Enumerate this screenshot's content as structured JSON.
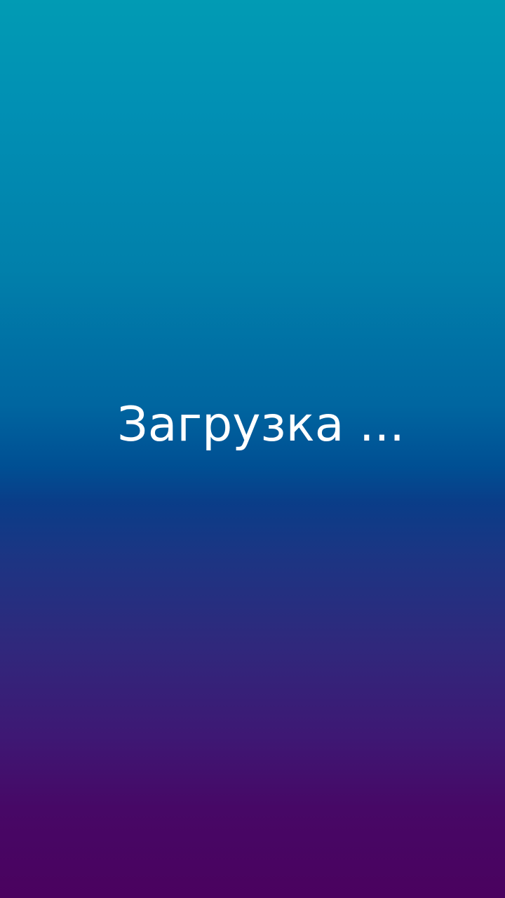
{
  "splash": {
    "loading_text": "Загрузка ...",
    "colors": {
      "top": "#019bb4",
      "middle": "#0a3d88",
      "bottom": "#4a025f",
      "text": "#ffffff"
    }
  }
}
